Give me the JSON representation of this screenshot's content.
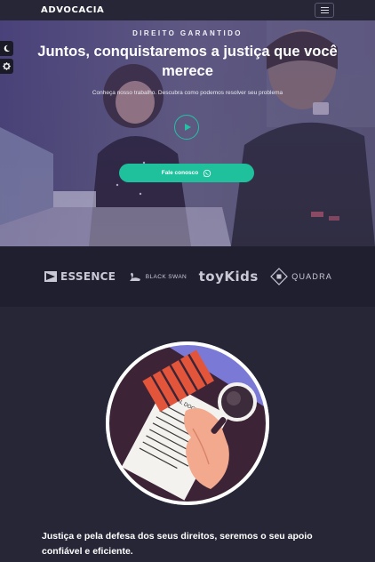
{
  "navbar": {
    "brand": "ADVOCACIA",
    "menu_icon": "hamburger-icon"
  },
  "side_tools": [
    {
      "name": "theme-toggle",
      "icon": "moon-icon"
    },
    {
      "name": "settings",
      "icon": "gear-icon"
    }
  ],
  "hero": {
    "eyebrow": "DIREITO GARANTIDO",
    "title": "Juntos, conquistaremos a justiça que você merece",
    "subtitle": "Conheça nosso trabalho. Descubra como podemos resolver seu problema",
    "play_icon": "play-icon",
    "cta_label": "Fale conosco",
    "cta_icon": "whatsapp-icon",
    "accent": "#1fc09c"
  },
  "clients": [
    {
      "name": "ESSENCE"
    },
    {
      "name": "BLACK SWAN"
    },
    {
      "name": "toyKids"
    },
    {
      "name": "QUADRA"
    }
  ],
  "feature": {
    "illustration_doc_text": "LEGAL DOCUMENT",
    "text": "Justiça e pela defesa dos seus direitos, seremos o seu apoio confiável e eficiente."
  }
}
